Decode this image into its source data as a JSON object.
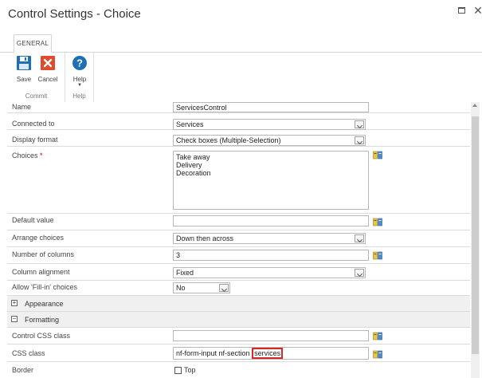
{
  "window": {
    "title": "Control Settings - Choice",
    "maximize_icon": "maximize-icon",
    "close_icon": "close-icon"
  },
  "tabs": [
    {
      "label": "GENERAL",
      "active": true
    }
  ],
  "ribbon": {
    "groups": [
      {
        "label": "Commit",
        "buttons": [
          {
            "label": "Save",
            "icon": "save-icon",
            "color": "#1e6fb5"
          },
          {
            "label": "Cancel",
            "icon": "cancel-icon",
            "color": "#e04b2d"
          }
        ]
      },
      {
        "label": "Help",
        "buttons": [
          {
            "label": "Help",
            "icon": "help-icon",
            "color": "#1e6fb5"
          }
        ]
      }
    ]
  },
  "form": {
    "name": {
      "label": "Name",
      "value": "ServicesControl"
    },
    "connected_to": {
      "label": "Connected to",
      "value": "Services"
    },
    "display_format": {
      "label": "Display format",
      "value": "Check boxes (Multiple-Selection)"
    },
    "choices": {
      "label": "Choices",
      "required_mark": "*",
      "values": [
        "Take away",
        "Delivery",
        "Decoration"
      ]
    },
    "default_value": {
      "label": "Default value",
      "value": ""
    },
    "arrange_choices": {
      "label": "Arrange choices",
      "value": "Down then across"
    },
    "number_of_columns": {
      "label": "Number of columns",
      "value": "3"
    },
    "column_alignment": {
      "label": "Column alignment",
      "value": "Fixed"
    },
    "allow_fill_in": {
      "label": "Allow 'Fill-in' choices",
      "value": "No"
    },
    "appearance_section": {
      "label": "Appearance",
      "toggle": "+"
    },
    "formatting_section": {
      "label": "Formatting",
      "toggle": "−"
    },
    "control_css_class": {
      "label": "Control CSS class",
      "value": ""
    },
    "css_class": {
      "label": "CSS class",
      "value_prefix": "nf-form-input nf-section",
      "value_highlight": "services"
    },
    "border": {
      "label": "Border",
      "option": "Top"
    }
  },
  "colors": {
    "highlight": "#d62828",
    "section_bg": "#f0f0f0",
    "border": "#b8b8b8"
  }
}
